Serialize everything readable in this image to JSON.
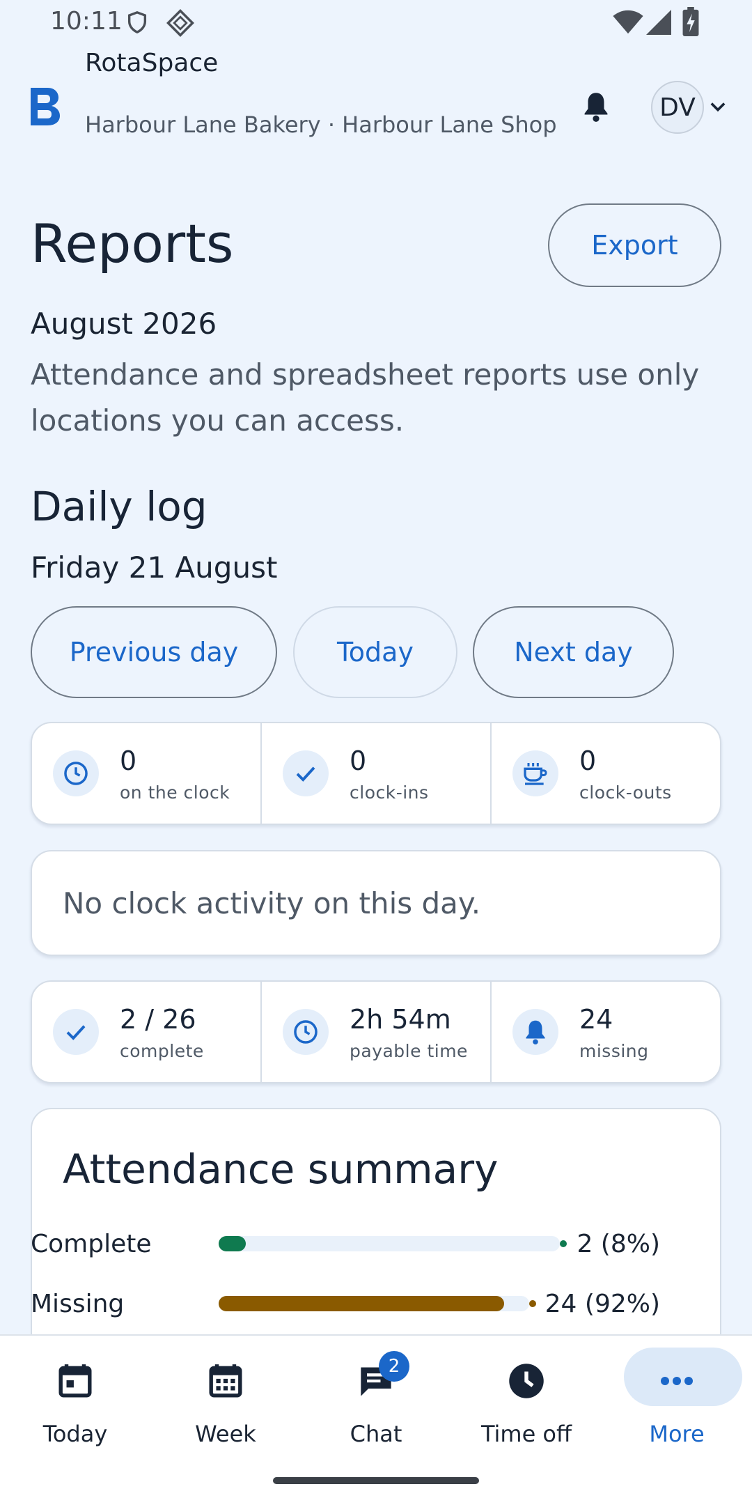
{
  "status_bar": {
    "time": "10:11"
  },
  "header": {
    "app_name": "RotaSpace",
    "workspace": "Harbour Lane Bakery · Harbour Lane Shop",
    "avatar_initials": "DV"
  },
  "page": {
    "title": "Reports",
    "export_label": "Export",
    "period": "August 2026",
    "scope_note": "Attendance and spreadsheet reports use only locations you can access."
  },
  "daily_log": {
    "title": "Daily log",
    "date": "Friday 21 August",
    "buttons": {
      "previous": "Previous day",
      "today": "Today",
      "next": "Next day"
    },
    "clock_stats": [
      {
        "value": "0",
        "label": "on the clock",
        "icon": "clock-icon"
      },
      {
        "value": "0",
        "label": "clock-ins",
        "icon": "check-icon"
      },
      {
        "value": "0",
        "label": "clock-outs",
        "icon": "coffee-icon"
      }
    ],
    "empty_message": "No clock activity on this day.",
    "progress_stats": [
      {
        "value": "2 / 26",
        "label": "complete",
        "icon": "check-icon"
      },
      {
        "value": "2h 54m",
        "label": "payable time",
        "icon": "clock-icon"
      },
      {
        "value": "24",
        "label": "missing",
        "icon": "bell-icon"
      }
    ]
  },
  "attendance_summary": {
    "title": "Attendance summary",
    "rows": [
      {
        "label": "Complete",
        "value": "2 (8%)",
        "fraction": 0.08,
        "color": "#0f7a4f"
      },
      {
        "label": "Missing",
        "value": "24 (92%)",
        "fraction": 0.92,
        "color": "#8a5a00"
      }
    ]
  },
  "bottom_nav": {
    "items": [
      {
        "label": "Today",
        "icon": "calendar-day-icon"
      },
      {
        "label": "Week",
        "icon": "calendar-week-icon"
      },
      {
        "label": "Chat",
        "icon": "chat-icon",
        "badge": "2"
      },
      {
        "label": "Time off",
        "icon": "clock-icon"
      },
      {
        "label": "More",
        "icon": "more-icon",
        "active": true
      }
    ]
  },
  "colors": {
    "accent": "#1b67c9",
    "background": "#edf4fd",
    "complete": "#0f7a4f",
    "missing": "#8a5a00"
  }
}
